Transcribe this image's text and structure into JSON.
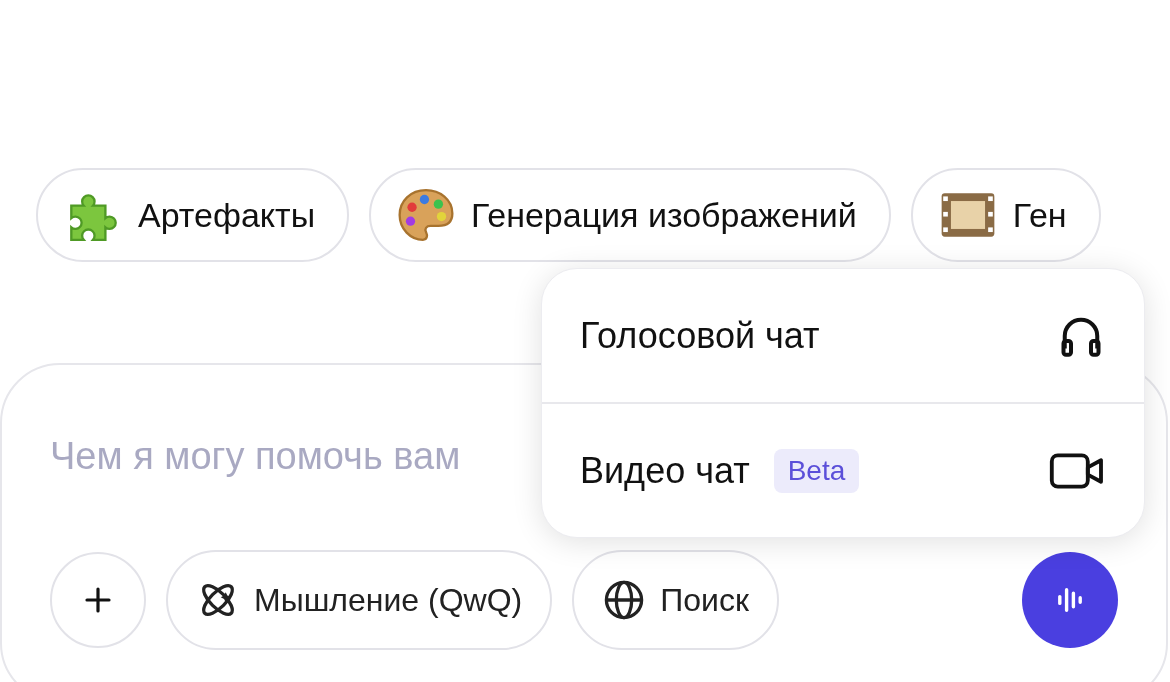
{
  "suggestion_chips": [
    {
      "label": "Артефакты",
      "kind": "puzzle"
    },
    {
      "label": "Генерация изображений",
      "kind": "palette"
    },
    {
      "label": "Ген",
      "kind": "film"
    }
  ],
  "composer": {
    "placeholder": "Чем я могу помочь вам",
    "tools": [
      {
        "label": "Мышление (QwQ)",
        "kind": "think"
      },
      {
        "label": "Поиск",
        "kind": "search"
      }
    ]
  },
  "voice_menu": {
    "items": [
      {
        "label": "Голосовой чат",
        "kind": "voice"
      },
      {
        "label": "Видео чат",
        "badge": "Beta",
        "kind": "video"
      }
    ]
  }
}
